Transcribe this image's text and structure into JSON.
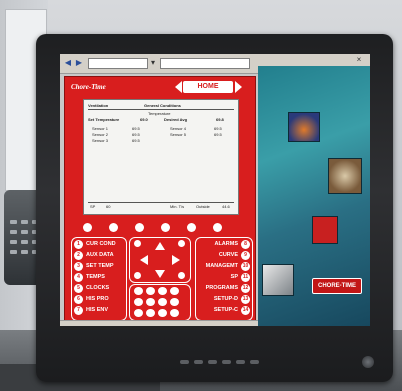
{
  "panel": {
    "home_label": "HOME",
    "lcd": {
      "title": "Ventilation",
      "title_right": "General Conditions",
      "subheader": "Temperature",
      "col_set": "Set Temperature",
      "col_status": "69.0",
      "col_exp": "Desired Avg",
      "col_val": "69.8",
      "rows": [
        {
          "a": "Sensor 1",
          "b": "69.5",
          "c": "Sensor 4",
          "d": "69.5"
        },
        {
          "a": "Sensor 2",
          "b": "69.5",
          "c": "Sensor 5",
          "d": "69.5"
        },
        {
          "a": "Sensor 3",
          "b": "69.5",
          "c": "",
          "d": ""
        }
      ],
      "footer_left": "SP",
      "footer_left_val": "60",
      "footer_mid": "Min. T/s",
      "footer_right": "Outside",
      "footer_right_val": "44.6"
    },
    "left_menu": [
      {
        "num": "1",
        "label": "CUR COND"
      },
      {
        "num": "2",
        "label": "AUX DATA"
      },
      {
        "num": "3",
        "label": "SET TEMP"
      },
      {
        "num": "4",
        "label": "TEMPS"
      },
      {
        "num": "5",
        "label": "CLOCKS"
      },
      {
        "num": "6",
        "label": "HIS PRO"
      },
      {
        "num": "7",
        "label": "HIS ENV"
      }
    ],
    "right_menu": [
      {
        "num": "8",
        "label": "ALARMS"
      },
      {
        "num": "9",
        "label": "CURVE"
      },
      {
        "num": "10",
        "label": "MANAGEMT"
      },
      {
        "num": "11",
        "label": "SP"
      },
      {
        "num": "12",
        "label": "PROGRAMS"
      },
      {
        "num": "13",
        "label": "SETUP-D"
      },
      {
        "num": "14",
        "label": "SETUP-C"
      }
    ]
  },
  "art": {
    "badge": "CHORE-TIME"
  },
  "colors": {
    "panel_red": "#d81e1e",
    "art_teal": "#2a7f8f"
  }
}
